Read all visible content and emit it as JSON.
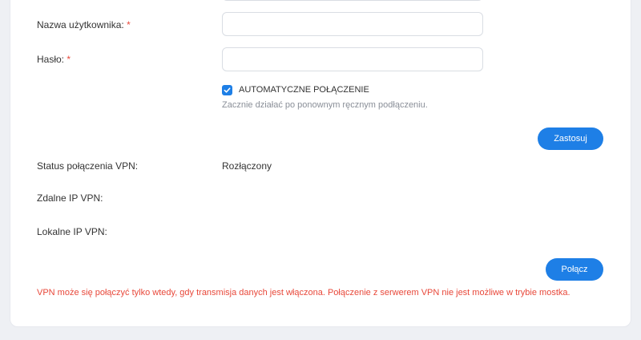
{
  "form": {
    "username": {
      "label": "Nazwa użytkownika:",
      "required_mark": "*",
      "value": "",
      "placeholder": ""
    },
    "password": {
      "label": "Hasło:",
      "required_mark": "*",
      "value": "",
      "placeholder": ""
    },
    "auto_connect": {
      "label": "AUTOMATYCZNE POŁĄCZENIE",
      "checked": true,
      "hint": "Zacznie działać po ponownym ręcznym podłączeniu."
    },
    "apply_label": "Zastosuj"
  },
  "status": {
    "connection_label": "Status połączenia VPN:",
    "connection_value": "Rozłączony",
    "remote_ip_label": "Zdalne IP VPN:",
    "remote_ip_value": "",
    "local_ip_label": "Lokalne IP VPN:",
    "local_ip_value": ""
  },
  "connect_label": "Połącz",
  "warning": "VPN może się połączyć tylko wtedy, gdy transmisja danych jest włączona. Połączenie z serwerem VPN nie jest możliwe w trybie mostka.",
  "colors": {
    "accent": "#1e7fe6",
    "required": "#e8483a",
    "warning": "#e8483a"
  }
}
